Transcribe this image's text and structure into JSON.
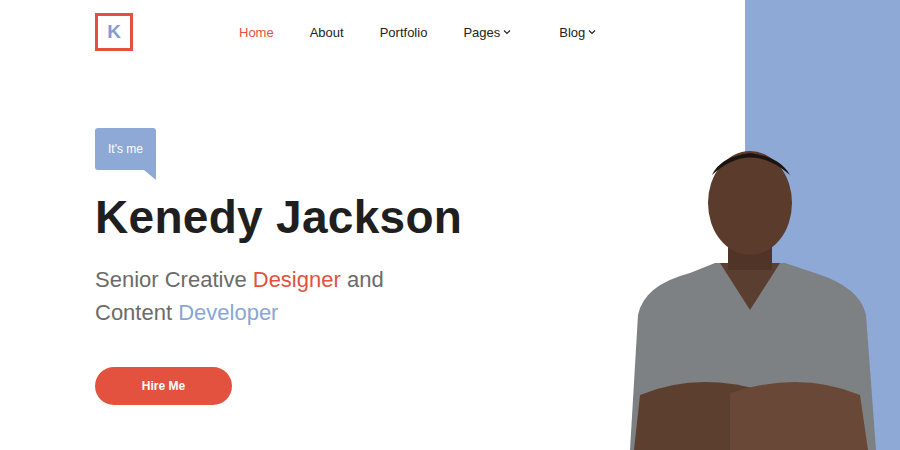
{
  "logo": {
    "letter": "K"
  },
  "nav": {
    "items": [
      {
        "label": "Home",
        "selected": true,
        "dropdown": false
      },
      {
        "label": "About",
        "selected": false,
        "dropdown": false
      },
      {
        "label": "Portfolio",
        "selected": false,
        "dropdown": false
      },
      {
        "label": "Pages",
        "selected": false,
        "dropdown": true
      },
      {
        "label": "Blog",
        "selected": false,
        "dropdown": true
      }
    ]
  },
  "hero": {
    "badge": "It's me",
    "name": "Kenedy Jackson",
    "subtitle": [
      [
        {
          "text": "Senior Creative ",
          "color": "#6b6b6b"
        },
        {
          "text": "Designer",
          "color": "#e2523f"
        },
        {
          "text": " and",
          "color": "#6b6b6b"
        }
      ],
      [
        {
          "text": "Content ",
          "color": "#6b6b6b"
        },
        {
          "text": "Developer",
          "color": "#8aa6d4"
        }
      ]
    ],
    "button": "Hire Me"
  }
}
